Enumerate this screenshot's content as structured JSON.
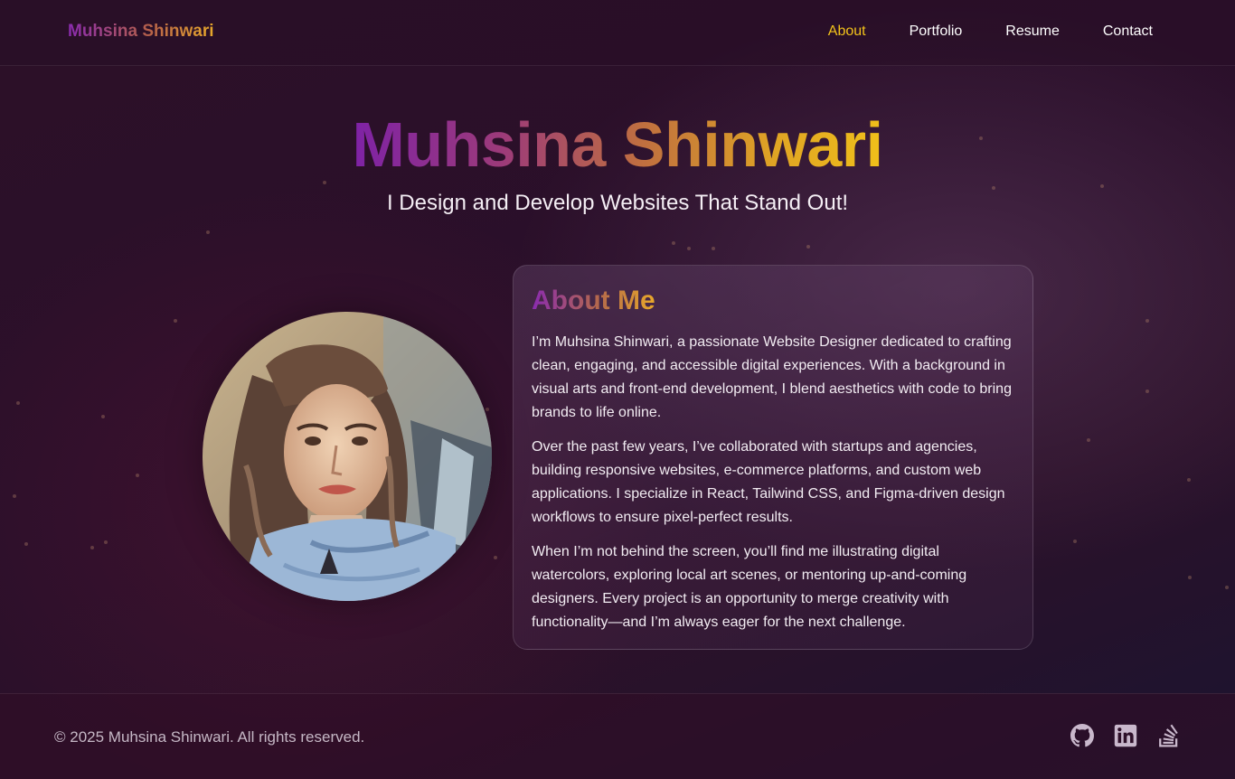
{
  "header": {
    "brand": "Muhsina Shinwari",
    "nav": [
      {
        "label": "About",
        "active": true
      },
      {
        "label": "Portfolio",
        "active": false
      },
      {
        "label": "Resume",
        "active": false
      },
      {
        "label": "Contact",
        "active": false
      }
    ]
  },
  "hero": {
    "title": "Muhsina Shinwari",
    "subtitle": "I Design and Develop Websites That Stand Out!"
  },
  "about": {
    "heading": "About Me",
    "paragraphs": [
      "I’m Muhsina Shinwari, a passionate Website Designer dedicated to crafting clean, engaging, and accessible digital experiences. With a background in visual arts and front-end development, I blend aesthetics with code to bring brands to life online.",
      "Over the past few years, I’ve collaborated with startups and agencies, building responsive websites, e-commerce platforms, and custom web applications. I specialize in React, Tailwind CSS, and Figma-driven design workflows to ensure pixel-perfect results.",
      "When I’m not behind the screen, you’ll find me illustrating digital watercolors, exploring local art scenes, or mentoring up-and-coming designers. Every project is an opportunity to merge creativity with functionality—and I’m always eager for the next challenge."
    ]
  },
  "footer": {
    "copyright": "© 2025 Muhsina Shinwari. All rights reserved.",
    "socials": [
      "github-icon",
      "linkedin-icon",
      "stackoverflow-icon"
    ]
  },
  "colors": {
    "accent_gold": "#f2c21a",
    "accent_purple": "#7e22a6",
    "background": "#2a0f2a"
  }
}
